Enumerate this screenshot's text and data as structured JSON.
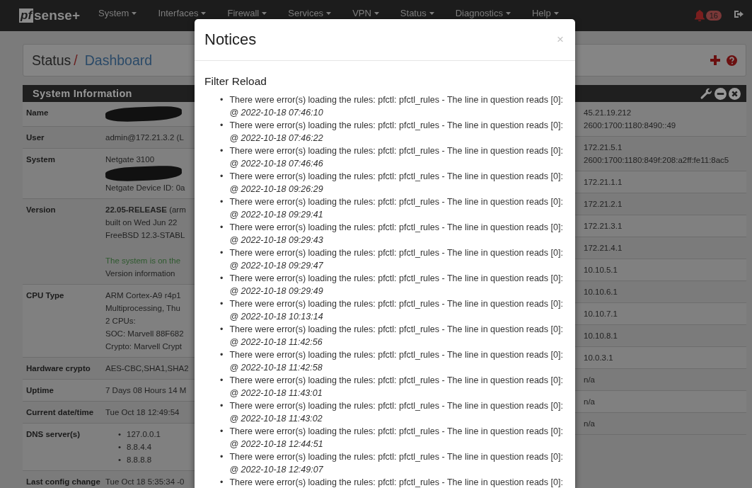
{
  "navbar": {
    "logo": {
      "mark": "pf",
      "word": "sense",
      "plus": "+"
    },
    "menu": [
      {
        "label": "System"
      },
      {
        "label": "Interfaces"
      },
      {
        "label": "Firewall"
      },
      {
        "label": "Services"
      },
      {
        "label": "VPN"
      },
      {
        "label": "Status"
      },
      {
        "label": "Diagnostics"
      },
      {
        "label": "Help"
      }
    ],
    "notice_count": "16"
  },
  "breadcrumb": {
    "section": "Status",
    "separator": "/",
    "page": "Dashboard"
  },
  "system_information": {
    "title": "System Information",
    "rows": [
      {
        "label": "Name",
        "lines": [
          {
            "kind": "redacted"
          }
        ]
      },
      {
        "label": "User",
        "lines": [
          {
            "kind": "text",
            "text": "admin@172.21.3.2 (L"
          }
        ]
      },
      {
        "label": "System",
        "lines": [
          {
            "kind": "text",
            "text": "Netgate 3100"
          },
          {
            "kind": "redacted"
          },
          {
            "kind": "text",
            "text": "Netgate Device ID: 0a"
          }
        ]
      },
      {
        "label": "Version",
        "lines": [
          {
            "kind": "text",
            "text": "**22.05-RELEASE** (arm"
          },
          {
            "kind": "text",
            "text": "built on Wed Jun 22"
          },
          {
            "kind": "text",
            "text": "FreeBSD 12.3-STABL"
          },
          {
            "kind": "status",
            "text": "The system is on the"
          },
          {
            "kind": "text",
            "text": "Version information"
          }
        ]
      },
      {
        "label": "CPU Type",
        "lines": [
          {
            "kind": "text",
            "text": "ARM Cortex-A9 r4p1"
          },
          {
            "kind": "text",
            "text": "Multiprocessing, Thu"
          },
          {
            "kind": "text",
            "text": "2 CPUs:"
          },
          {
            "kind": "text",
            "text": "SOC: Marvell 88F682"
          },
          {
            "kind": "text",
            "text": "Crypto: Marvell Crypt"
          }
        ]
      },
      {
        "label": "Hardware crypto",
        "lines": [
          {
            "kind": "text",
            "text": "AES-CBC,SHA1,SHA2"
          }
        ]
      },
      {
        "label": "Uptime",
        "lines": [
          {
            "kind": "text",
            "text": "7 Days 08 Hours 14 M"
          }
        ]
      },
      {
        "label": "Current date/time",
        "lines": [
          {
            "kind": "text",
            "text": "Tue Oct 18 12:49:54"
          }
        ]
      },
      {
        "label": "DNS server(s)",
        "lines": [
          {
            "kind": "bullet",
            "marker": "•",
            "text": "127.0.0.1"
          },
          {
            "kind": "bullet",
            "marker": "•",
            "text": "8.8.4.4"
          },
          {
            "kind": "bullet",
            "marker": "•",
            "text": "8.8.8.8"
          }
        ]
      },
      {
        "label": "Last config change",
        "lines": [
          {
            "kind": "text",
            "text": "Tue Oct 18 5:35:34 -0"
          }
        ]
      }
    ]
  },
  "interfaces_widget": {
    "rows": [
      {
        "lines": [
          "45.21.19.212",
          "2600:1700:1180:8490::49"
        ]
      },
      {
        "lines": [
          "172.21.5.1",
          "2600:1700:1180:849f:208:a2ff:fe11:8ac5"
        ]
      },
      {
        "lines": [
          "172.21.1.1"
        ]
      },
      {
        "lines": [
          "172.21.2.1"
        ]
      },
      {
        "lines": [
          "172.21.3.1"
        ]
      },
      {
        "lines": [
          "172.21.4.1"
        ]
      },
      {
        "lines": [
          "10.10.5.1"
        ]
      },
      {
        "lines": [
          "10.10.6.1"
        ]
      },
      {
        "lines": [
          "10.10.7.1"
        ]
      },
      {
        "lines": [
          "10.10.8.1"
        ]
      },
      {
        "lines": [
          "10.0.3.1"
        ]
      },
      {
        "lines": [
          "n/a"
        ]
      },
      {
        "lines": [
          "n/a"
        ]
      },
      {
        "lines": [
          "n/a"
        ]
      }
    ]
  },
  "notices_dialog": {
    "title": "Notices",
    "close": "×",
    "section": "Filter Reload",
    "marker": "•",
    "items": [
      {
        "message": "There were error(s) loading the rules: pfctl: pfctl_rules - The line in question reads [0]:",
        "time": "@ 2022-10-18 07:46:10"
      },
      {
        "message": "There were error(s) loading the rules: pfctl: pfctl_rules - The line in question reads [0]:",
        "time": "@ 2022-10-18 07:46:22"
      },
      {
        "message": "There were error(s) loading the rules: pfctl: pfctl_rules - The line in question reads [0]:",
        "time": "@ 2022-10-18 07:46:46"
      },
      {
        "message": "There were error(s) loading the rules: pfctl: pfctl_rules - The line in question reads [0]:",
        "time": "@ 2022-10-18 09:26:29"
      },
      {
        "message": "There were error(s) loading the rules: pfctl: pfctl_rules - The line in question reads [0]:",
        "time": "@ 2022-10-18 09:29:41"
      },
      {
        "message": "There were error(s) loading the rules: pfctl: pfctl_rules - The line in question reads [0]:",
        "time": "@ 2022-10-18 09:29:43"
      },
      {
        "message": "There were error(s) loading the rules: pfctl: pfctl_rules - The line in question reads [0]:",
        "time": "@ 2022-10-18 09:29:47"
      },
      {
        "message": "There were error(s) loading the rules: pfctl: pfctl_rules - The line in question reads [0]:",
        "time": "@ 2022-10-18 09:29:49"
      },
      {
        "message": "There were error(s) loading the rules: pfctl: pfctl_rules - The line in question reads [0]:",
        "time": "@ 2022-10-18 10:13:14"
      },
      {
        "message": "There were error(s) loading the rules: pfctl: pfctl_rules - The line in question reads [0]:",
        "time": "@ 2022-10-18 11:42:56"
      },
      {
        "message": "There were error(s) loading the rules: pfctl: pfctl_rules - The line in question reads [0]:",
        "time": "@ 2022-10-18 11:42:58"
      },
      {
        "message": "There were error(s) loading the rules: pfctl: pfctl_rules - The line in question reads [0]:",
        "time": "@ 2022-10-18 11:43:01"
      },
      {
        "message": "There were error(s) loading the rules: pfctl: pfctl_rules - The line in question reads [0]:",
        "time": "@ 2022-10-18 11:43:02"
      },
      {
        "message": "There were error(s) loading the rules: pfctl: pfctl_rules - The line in question reads [0]:",
        "time": "@ 2022-10-18 12:44:51"
      },
      {
        "message": "There were error(s) loading the rules: pfctl: pfctl_rules - The line in question reads [0]:",
        "time": "@ 2022-10-18 12:49:07"
      },
      {
        "message": "There were error(s) loading the rules: pfctl: pfctl_rules - The line in question reads [0]:"
      }
    ]
  }
}
